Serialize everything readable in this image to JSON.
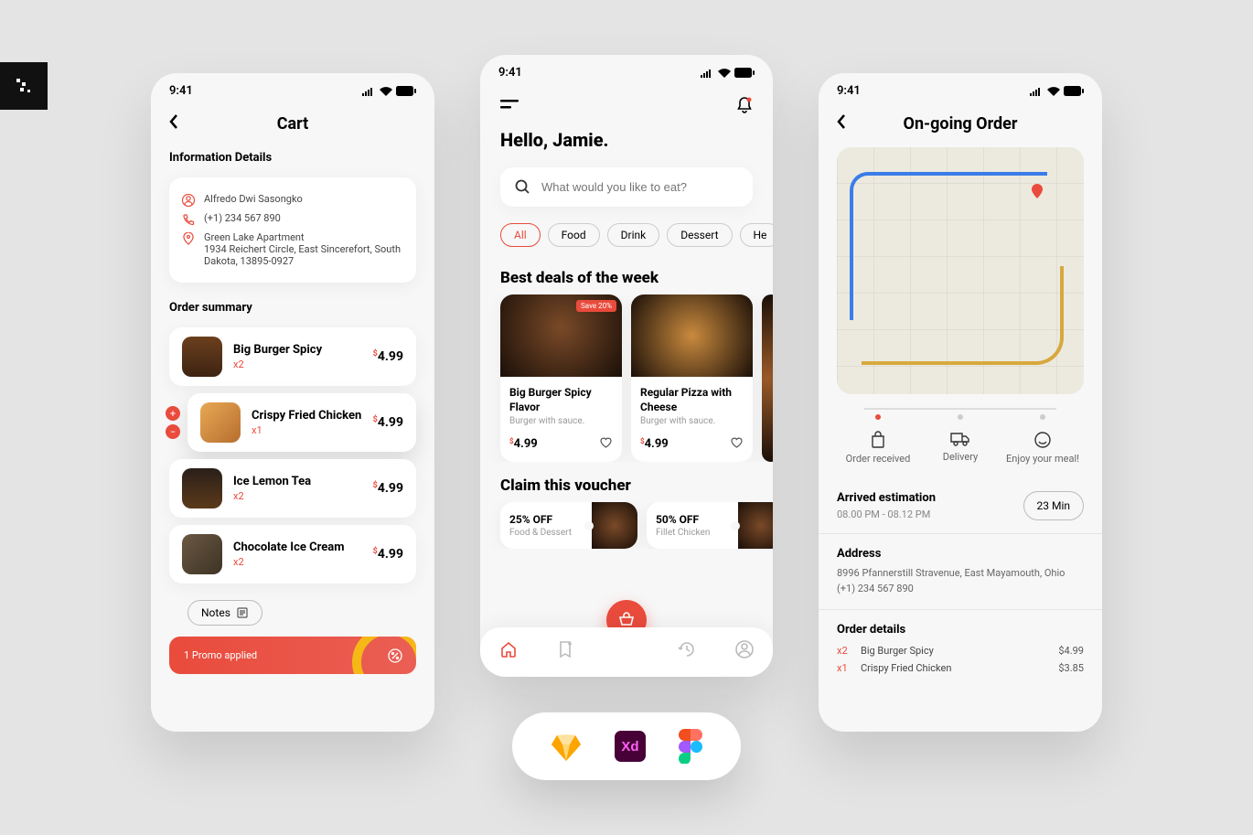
{
  "status_time": "9:41",
  "cart": {
    "title": "Cart",
    "info_title": "Information Details",
    "name": "Alfredo Dwi Sasongko",
    "phone": "(+1) 234 567 890",
    "address": "Green Lake Apartment\n1934 Reichert Circle, East Sincerefort, South Dakota, 13895-0927",
    "summary_title": "Order summary",
    "items": [
      {
        "name": "Big Burger Spicy",
        "qty": "x2",
        "price": "4.99"
      },
      {
        "name": "Crispy Fried Chicken",
        "qty": "x1",
        "price": "4.99"
      },
      {
        "name": "Ice Lemon Tea",
        "qty": "x2",
        "price": "4.99"
      },
      {
        "name": "Chocolate Ice Cream",
        "qty": "x2",
        "price": "4.99"
      }
    ],
    "notes_label": "Notes",
    "promo": "1 Promo applied"
  },
  "home": {
    "greeting": "Hello, Jamie.",
    "search_placeholder": "What would you like to eat?",
    "chips": [
      "All",
      "Food",
      "Drink",
      "Dessert",
      "He"
    ],
    "deals_title": "Best deals of the week",
    "deals": [
      {
        "name": "Big Burger Spicy Flavor",
        "desc": "Burger with sauce.",
        "price": "4.99",
        "badge": "Save 20%"
      },
      {
        "name": "Regular Pizza with Cheese",
        "desc": "Burger with sauce.",
        "price": "4.99"
      }
    ],
    "voucher_title": "Claim this  voucher",
    "vouchers": [
      {
        "title": "25% OFF",
        "sub": "Food & Dessert"
      },
      {
        "title": "50% OFF",
        "sub": "Fillet Chicken"
      }
    ]
  },
  "order": {
    "title": "On-going Order",
    "steps": [
      "Order received",
      "Delivery",
      "Enjoy your meal!"
    ],
    "eta_label": "Arrived estimation",
    "eta_time": "08.00 PM - 08.12 PM",
    "eta_badge": "23 Min",
    "addr_label": "Address",
    "addr_text": "8996 Pfannerstill Stravenue, East Mayamouth, Ohio",
    "addr_phone": "(+1) 234 567 890",
    "details_label": "Order details",
    "details": [
      {
        "qty": "x2",
        "name": "Big Burger Spicy",
        "price": "$4.99"
      },
      {
        "qty": "x1",
        "name": "Crispy Fried Chicken",
        "price": "$3.85"
      }
    ]
  },
  "currency": "$"
}
